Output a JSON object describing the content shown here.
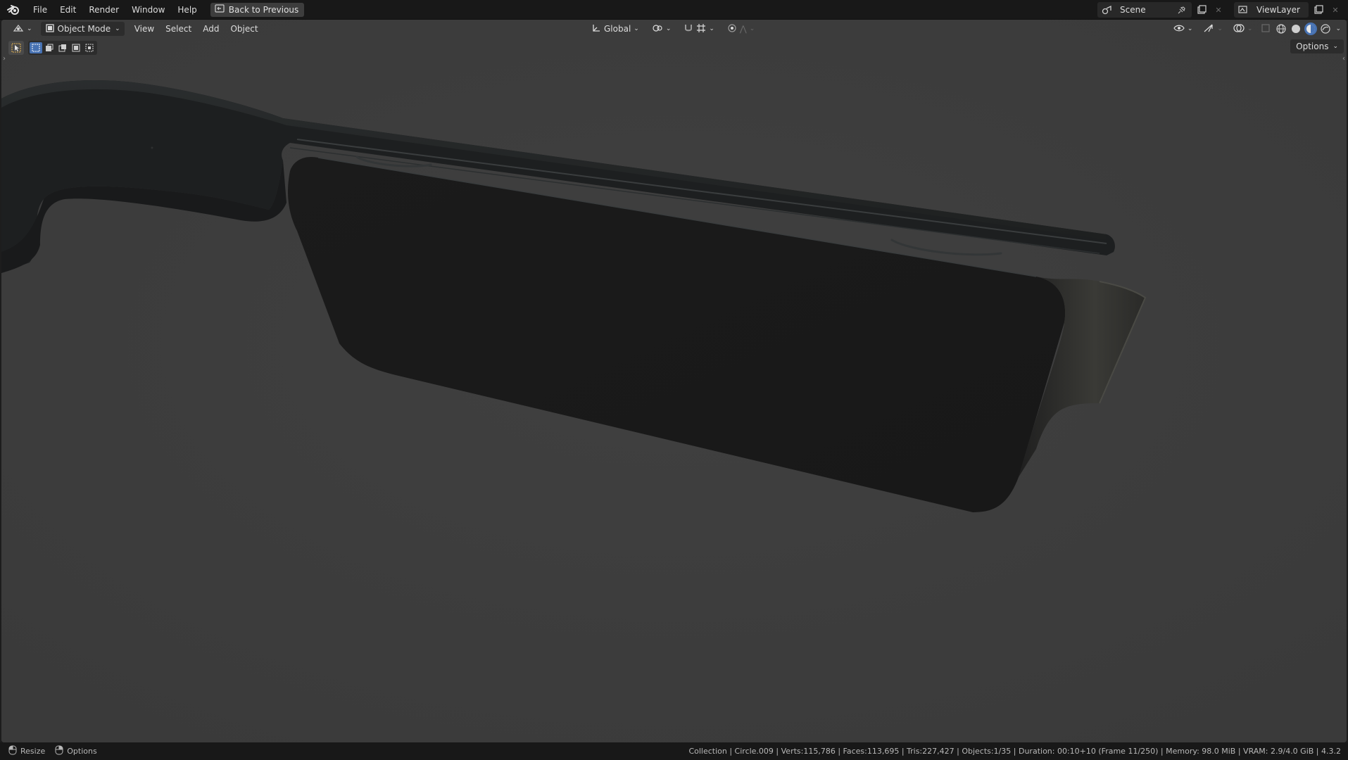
{
  "menu": {
    "items": [
      "File",
      "Edit",
      "Render",
      "Window",
      "Help"
    ],
    "back_button": "Back to Previous"
  },
  "topbar_right": {
    "scene": "Scene",
    "view_layer": "ViewLayer"
  },
  "viewport_header": {
    "mode": "Object Mode",
    "menus": [
      "View",
      "Select",
      "Add",
      "Object"
    ],
    "transform_orientation": "Global",
    "options_label": "Options"
  },
  "colors": {
    "accent": "#4772b3",
    "viewport_bg": "#3d3d3d",
    "model": "#1c1c1c"
  },
  "status": {
    "resize_label": "Resize",
    "options_label": "Options",
    "info": "Collection | Circle.009 | Verts:115,786 | Faces:113,695 | Tris:227,427 | Objects:1/35 | Duration: 00:10+10 (Frame 11/250) | Memory: 98.0 MiB | VRAM: 2.9/4.0 GiB | 4.3.2"
  },
  "icons": {
    "logo": "blender-logo-icon",
    "back": "back-icon",
    "scene": "scene-icon",
    "pin": "pin-icon",
    "new": "new-scene-icon",
    "close": "close-icon",
    "view_layer": "view-layer-icon",
    "editor_type": "3d-viewport-icon",
    "object_mode": "object-mode-icon",
    "orientation": "axis-icon",
    "pivot": "pivot-icon",
    "snap": "magnet-icon",
    "proportional": "proportional-icon",
    "visibility": "eye-icon",
    "gizmo": "gizmo-icon",
    "overlay": "overlay-icon",
    "xray": "xray-icon",
    "wireframe": "wireframe-shading-icon",
    "solid": "solid-shading-icon",
    "material": "material-shading-icon",
    "rendered": "rendered-shading-icon"
  }
}
